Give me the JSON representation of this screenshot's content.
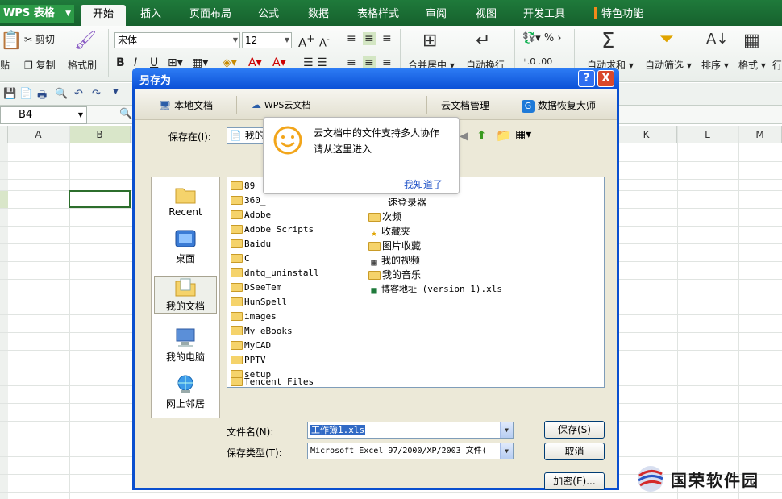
{
  "app": {
    "name": "WPS 表格"
  },
  "menu_tabs": [
    "开始",
    "插入",
    "页面布局",
    "公式",
    "数据",
    "表格样式",
    "审阅",
    "视图",
    "开发工具",
    "特色功能"
  ],
  "ribbon": {
    "clipboard": {
      "cut": "剪切",
      "paste": "贴",
      "copy": "复制",
      "format_painter": "格式刷"
    },
    "font_name": "宋体",
    "font_size": "12",
    "merge_center": "合并居中",
    "wrap_text": "自动换行",
    "auto_sum": "自动求和",
    "auto_filter": "自动筛选",
    "sort": "排序",
    "format": "格式",
    "row_col": "行"
  },
  "name_box": {
    "value": "B4"
  },
  "sheet": {
    "columns": [
      "A",
      "B",
      "K",
      "L",
      "M"
    ],
    "selected_cell": "B4"
  },
  "dialog": {
    "title": "另存为",
    "help_btn": "?",
    "close_btn": "X",
    "cloud_bar": {
      "local_docs": "本地文档",
      "wps_cloud": "WPS云文档",
      "cloud_manage": "云文档管理",
      "data_recovery": "数据恢复大师"
    },
    "save_in_label": "保存在(I):",
    "save_in_value": "我的",
    "places": [
      "Recent",
      "桌面",
      "我的文档",
      "我的电脑",
      "网上邻居"
    ],
    "files_col1": [
      "89",
      "360_",
      "Adobe",
      "Adobe Scripts",
      "Baidu",
      "C",
      "dntg_uninstall",
      "DSeeTem",
      "HunSpell",
      "images",
      "My eBooks",
      "MyCAD",
      "PPTV",
      "setup",
      "Tencent Files"
    ],
    "files_col2": [
      "速登录器",
      "次频",
      "收藏夹",
      "图片收藏",
      "我的视频",
      "我的音乐",
      "博客地址 (version 1).xls"
    ],
    "filename_label": "文件名(N):",
    "filename_value": "工作簿1.xls",
    "filetype_label": "保存类型(T):",
    "filetype_value": "Microsoft Excel 97/2000/XP/2003 文件(",
    "save_btn": "保存(S)",
    "cancel_btn": "取消",
    "encrypt_btn": "加密(E)..."
  },
  "tooltip": {
    "line1": "云文档中的文件支持多人协作",
    "line2": "请从这里进入",
    "ok_link": "我知道了"
  },
  "watermark": "国荣软件园"
}
